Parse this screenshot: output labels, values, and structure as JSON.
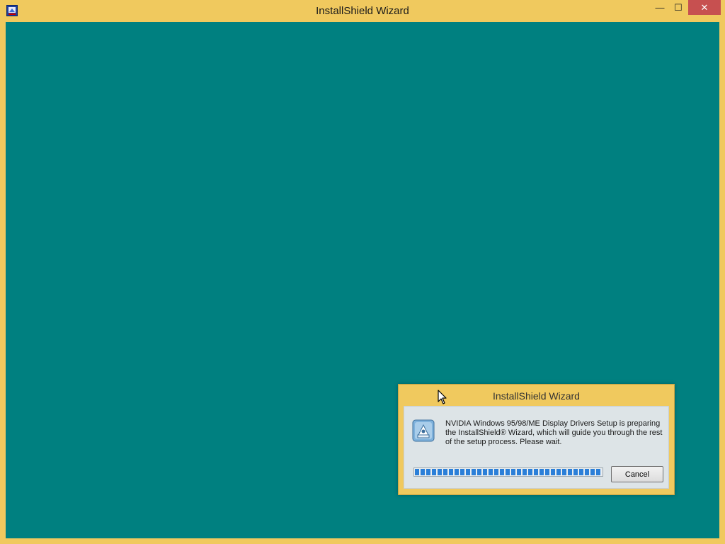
{
  "window": {
    "title": "InstallShield Wizard",
    "icon": "installshield-app-icon",
    "controls": {
      "minimize": "—",
      "maximize": "☐",
      "close": "✕"
    },
    "client_background": "#008080",
    "frame_color": "#f0c95e"
  },
  "dialog": {
    "title": "InstallShield Wizard",
    "icon": "setup-package-icon",
    "message": "NVIDIA Windows 95/98/ME Display Drivers Setup is preparing the InstallShield® Wizard, which will guide you through the rest of the setup process. Please wait.",
    "progress": 1.0,
    "progress_color": "#2b7fd8",
    "cancel_label": "Cancel"
  },
  "cursor": {
    "icon": "arrow-cursor-icon"
  }
}
